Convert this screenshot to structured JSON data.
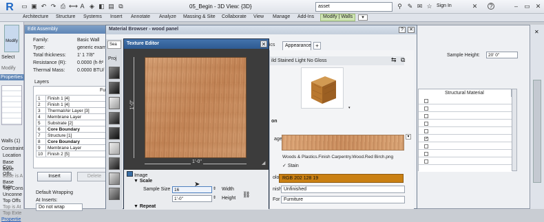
{
  "titlebar": {
    "doc_title": "05_Begin - 3D View: {3D}",
    "search_value": "asset",
    "signin_label": "Sign In",
    "help_label": "?"
  },
  "ribbon": {
    "tabs": [
      "Architecture",
      "Structure",
      "Systems",
      "Insert",
      "Annotate",
      "Analyze",
      "Massing & Site",
      "Collaborate",
      "View",
      "Manage",
      "Add-Ins",
      "Modify | Walls"
    ]
  },
  "left_strip": {
    "modify_label": "Modify",
    "select_label": "Select",
    "properties_label": "Properties",
    "walls_label": "Walls (1)",
    "items": [
      "Constraint",
      "Location",
      "Base Con",
      "Base Offs",
      "Base is A",
      "Base Exte",
      "Top Cons",
      "Unconne",
      "Top Offs",
      "Top is At",
      "Top Exte"
    ],
    "properties_link": "Propertie"
  },
  "edit_assembly": {
    "title": "Edit Assembly",
    "family_label": "Family:",
    "family_value": "Basic Wall",
    "type_label": "Type:",
    "type_value": "generic exam",
    "thickness_label": "Total thickness:",
    "thickness_value": "1' 1 7/8\"",
    "resistance_label": "Resistance (R):",
    "resistance_value": "0.0000 (h·ft²",
    "thermal_label": "Thermal Mass:",
    "thermal_value": "0.0000 BTU/",
    "layers_label": "Layers",
    "function_header": "Fu",
    "layers": [
      {
        "num": "1",
        "name": "Finish 1 [4]"
      },
      {
        "num": "2",
        "name": "Finish 1 [4]"
      },
      {
        "num": "3",
        "name": "Thermal/Air Layer [3]"
      },
      {
        "num": "4",
        "name": "Membrane Layer"
      },
      {
        "num": "5",
        "name": "Substrate [2]"
      },
      {
        "num": "6",
        "name": "Core Boundary"
      },
      {
        "num": "7",
        "name": "Structure [1]"
      },
      {
        "num": "8",
        "name": "Core Boundary"
      },
      {
        "num": "9",
        "name": "Membrane Layer"
      },
      {
        "num": "10",
        "name": "Finish 2 [5]"
      }
    ],
    "insert_label": "Insert",
    "delete_label": "Delete",
    "default_wrapping_label": "Default Wrapping",
    "at_inserts_label": "At Inserts:",
    "at_inserts_value": "Do not wrap"
  },
  "material_browser": {
    "title": "Material Browser - wood panel",
    "search_stub": "Sea",
    "proj_stub": "Proj",
    "help_label": "?",
    "close_label": "✕",
    "tab_graphics": "phics",
    "tab_appearance": "Appearance",
    "tab_add": "+",
    "asset_name": "ild Stained Light No Gloss",
    "section_label": "on",
    "image_row_label": "age",
    "image_filename": "Woods & Plastics.Finish Carpentry.Wood.Red Birch.png",
    "stain_label": "Stain",
    "color_label": "olor",
    "color_value": "RGB 202 128 19",
    "finish_label": "nish",
    "finish_value": "Unfinished",
    "used_for_label": "For",
    "used_for_value": "Furniture",
    "accent_color": "#ca8013"
  },
  "texture_editor": {
    "title": "Texture Editor",
    "close_label": "✕",
    "dim_vertical": "1'-0\"",
    "dim_horizontal": "1'-0\"",
    "image_label": "Image",
    "scale_label": "Scale",
    "sample_size_label": "Sample Size",
    "sample_size_value": "16",
    "width_label": "Width",
    "height_value": "1'-0\"",
    "height_label": "Height",
    "repeat_label": "Repeat"
  },
  "right_panel": {
    "sample_height_label": "Sample Height:",
    "sample_height_value": "20'  0\"",
    "structural_material_header": "Structural Material"
  }
}
